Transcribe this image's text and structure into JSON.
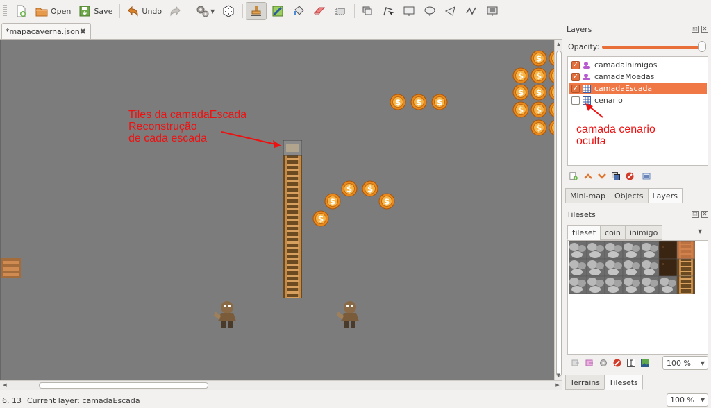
{
  "toolbar": {
    "open_label": "Open",
    "save_label": "Save",
    "undo_label": "Undo"
  },
  "document_tab": {
    "title": "*mapacaverna.json"
  },
  "map": {
    "annotation_ladder": [
      "Tiles da camadaEscada",
      "Reconstrução",
      "de cada escada"
    ],
    "annotation_layer": [
      "camada cenario",
      "oculta"
    ]
  },
  "layers_panel": {
    "title": "Layers",
    "opacity_label": "Opacity:",
    "opacity_value": 1.0,
    "layers": [
      {
        "name": "camadaInimigos",
        "visible": true,
        "type": "object",
        "selected": false
      },
      {
        "name": "camadaMoedas",
        "visible": true,
        "type": "object",
        "selected": false
      },
      {
        "name": "camadaEscada",
        "visible": true,
        "type": "tile",
        "selected": true
      },
      {
        "name": "cenario",
        "visible": false,
        "type": "tile",
        "selected": false
      }
    ],
    "tabs": [
      "Mini-map",
      "Objects",
      "Layers"
    ],
    "active_tab": "Layers"
  },
  "tilesets_panel": {
    "title": "Tilesets",
    "tabs": [
      "tileset",
      "coin",
      "inimigo"
    ],
    "active_tab": "tileset",
    "zoom": "100 %",
    "bottom_tabs": [
      "Terrains",
      "Tilesets"
    ],
    "active_bottom_tab": "Tilesets"
  },
  "status_bar": {
    "coords": "6, 13",
    "current_layer": "Current layer: camadaEscada",
    "zoom": "100 %"
  },
  "colors": {
    "accent": "#f07746",
    "map_bg": "#7c7c7c",
    "annotation": "#ee1111"
  }
}
